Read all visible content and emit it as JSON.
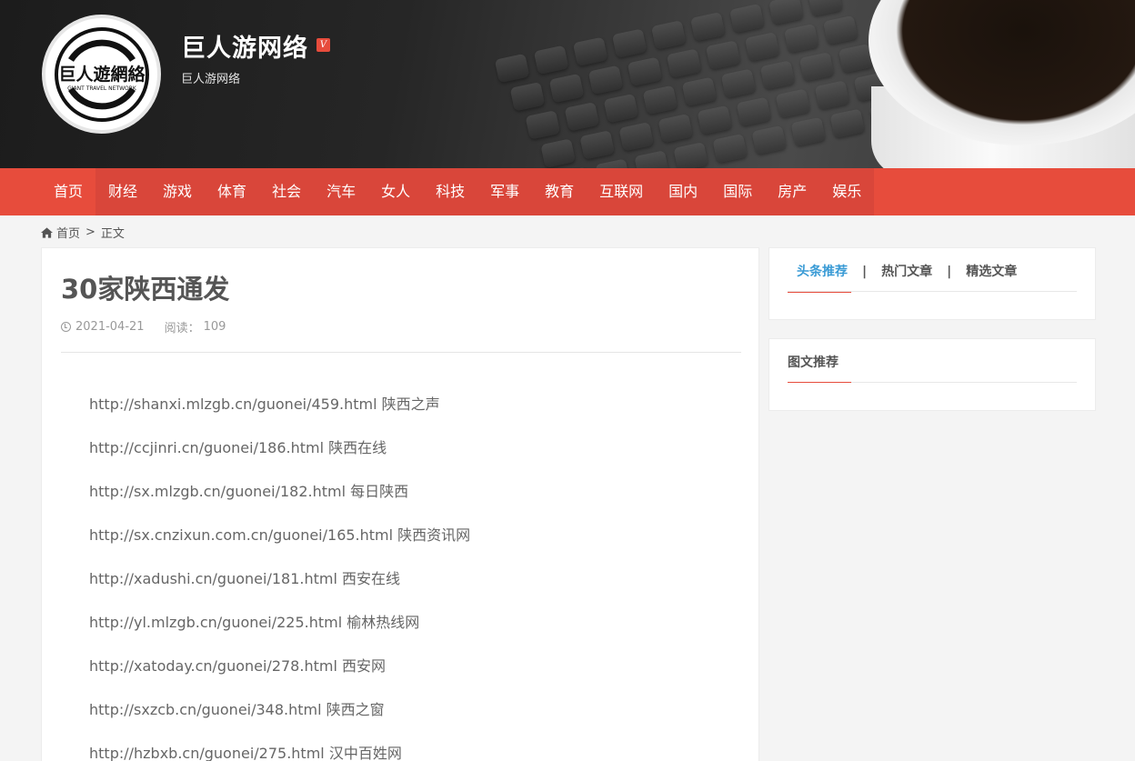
{
  "header": {
    "title": "巨人游网络",
    "verified_badge": "V",
    "subtitle": "巨人游网络",
    "logo_text": "巨人遊網絡",
    "logo_subtext": "GIANT TRAVEL NETWORK"
  },
  "nav": {
    "items": [
      "首页",
      "财经",
      "游戏",
      "体育",
      "社会",
      "汽车",
      "女人",
      "科技",
      "军事",
      "教育",
      "互联网",
      "国内",
      "国际",
      "房产",
      "娱乐"
    ]
  },
  "breadcrumb": {
    "home": "首页",
    "separator": ">",
    "current": "正文"
  },
  "article": {
    "title": "30家陕西通发",
    "date": "2021-04-21",
    "reads_label": "阅读：",
    "reads_count": "109",
    "paragraphs": [
      "http://shanxi.mlzgb.cn/guonei/459.html 陕西之声",
      "http://ccjinri.cn/guonei/186.html 陕西在线",
      "http://sx.mlzgb.cn/guonei/182.html 每日陕西",
      "http://sx.cnzixun.com.cn/guonei/165.html 陕西资讯网",
      "http://xadushi.cn/guonei/181.html 西安在线",
      "http://yl.mlzgb.cn/guonei/225.html 榆林热线网",
      "http://xatoday.cn/guonei/278.html 西安网",
      "http://sxzcb.cn/guonei/348.html 陕西之窗",
      "http://hzbxb.cn/guonei/275.html 汉中百姓网"
    ]
  },
  "sidebar": {
    "tabs": [
      "头条推荐",
      "热门文章",
      "精选文章"
    ],
    "tab_separator": "|",
    "image_box_title": "图文推荐"
  },
  "colors": {
    "accent": "#e74c3c",
    "nav_alt": "#d9463a",
    "active_tab": "#3a9bd5"
  },
  "icons": {
    "breadcrumb_home": "home-icon",
    "meta_date": "clock-icon"
  }
}
